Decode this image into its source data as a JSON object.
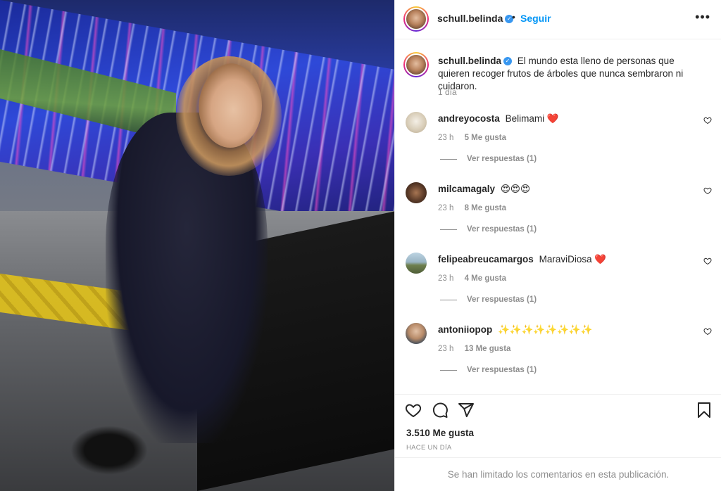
{
  "post": {
    "username": "schull.belinda",
    "follow_label": "Seguir",
    "separator": "•",
    "more_label": "•••",
    "caption": "El mundo esta lleno de personas que quieren recoger frutos de árboles que nunca sembraron ni cuidaron.",
    "caption_time": "1 día"
  },
  "comments": [
    {
      "username": "andreyocosta",
      "text": "Belimami ❤️",
      "time": "23 h",
      "likes": "5 Me gusta",
      "replies": "Ver respuestas (1)"
    },
    {
      "username": "milcamagaly",
      "text": "😍😍😍",
      "time": "23 h",
      "likes": "8 Me gusta",
      "replies": "Ver respuestas (1)"
    },
    {
      "username": "felipeabreucamargos",
      "text": "MaraviDiosa ❤️",
      "time": "23 h",
      "likes": "4 Me gusta",
      "replies": "Ver respuestas (1)"
    },
    {
      "username": "antoniiopop",
      "text": "✨✨✨✨✨✨✨✨",
      "time": "23 h",
      "likes": "13 Me gusta",
      "replies": "Ver respuestas (1)"
    }
  ],
  "footer": {
    "likes_count": "3.510 Me gusta",
    "date": "HACE UN DÍA",
    "comments_limited": "Se han limitado los comentarios en esta publicación."
  },
  "colors": {
    "accent": "#0095f6",
    "verified": "#3897f0",
    "secondary_text": "#8e8e8e"
  },
  "icons": [
    "verified-badge-icon",
    "more-options-icon",
    "heart-icon",
    "comment-icon",
    "share-icon",
    "bookmark-icon"
  ]
}
